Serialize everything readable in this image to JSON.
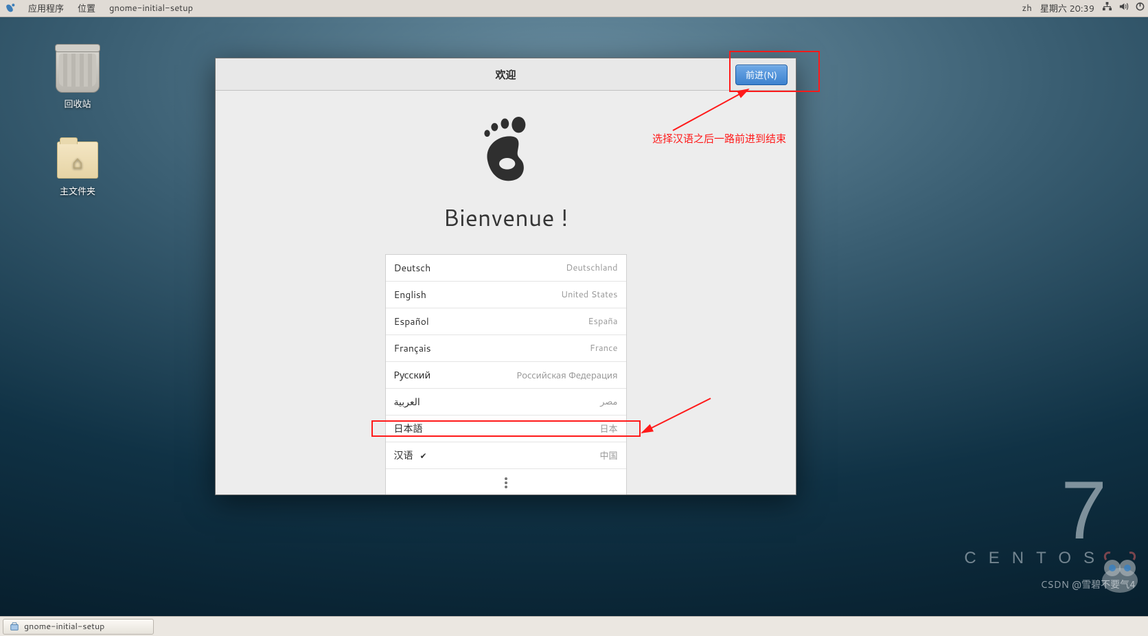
{
  "topbar": {
    "applications": "应用程序",
    "places": "位置",
    "app": "gnome-initial-setup",
    "lang_indicator": "zh",
    "clock": "星期六 20:39"
  },
  "desktop_icons": {
    "trash": "回收站",
    "home": "主文件夹"
  },
  "dialog": {
    "title": "欢迎",
    "next": "前进(N)",
    "welcome": "Bienvenue !",
    "langs": [
      {
        "name": "Deutsch",
        "country": "Deutschland",
        "selected": false
      },
      {
        "name": "English",
        "country": "United States",
        "selected": false
      },
      {
        "name": "Español",
        "country": "España",
        "selected": false
      },
      {
        "name": "Français",
        "country": "France",
        "selected": false
      },
      {
        "name": "Русский",
        "country": "Российская Федерация",
        "selected": false
      },
      {
        "name": "العربية",
        "country": "مصر",
        "selected": false
      },
      {
        "name": "日本語",
        "country": "日本",
        "selected": false
      },
      {
        "name": "汉语",
        "country": "中国",
        "selected": true
      }
    ]
  },
  "annotation": {
    "hint": "选择汉语之后一路前进到结束"
  },
  "taskbar": {
    "task": "gnome-initial-setup"
  },
  "branding": {
    "seven": "7",
    "name": "CENTOS"
  },
  "watermark": "CSDN @雪碧不要气4"
}
